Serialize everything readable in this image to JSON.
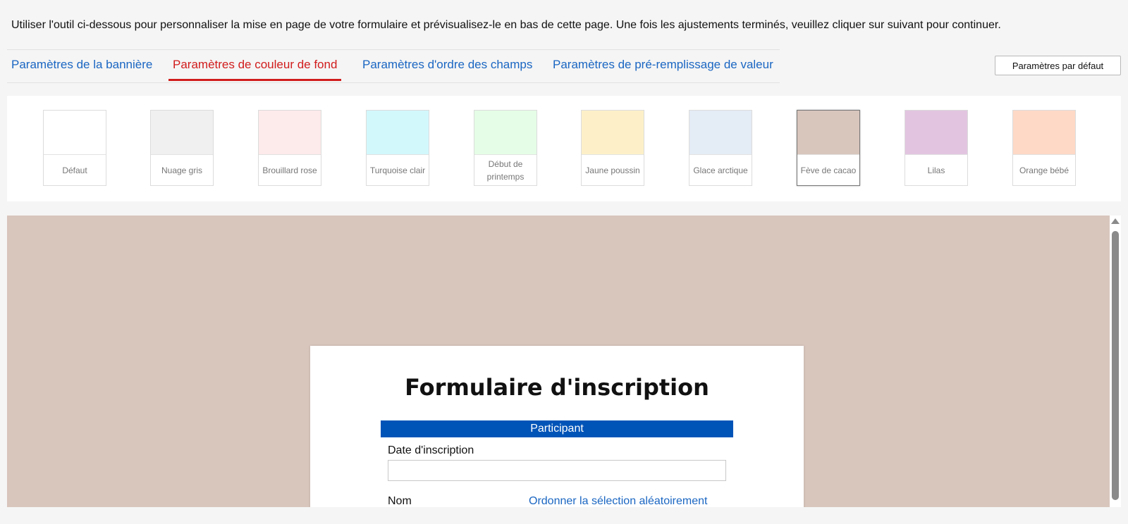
{
  "intro_text": "Utiliser l'outil ci-dessous pour personnaliser la mise en page de votre formulaire et prévisualisez-le en bas de cette page. Une fois les ajustements terminés, veuillez cliquer sur suivant pour continuer.",
  "tabs": [
    {
      "label": "Paramètres de la bannière",
      "active": false
    },
    {
      "label": "Paramètres de couleur de fond",
      "active": true
    },
    {
      "label": "Paramètres d'ordre des champs",
      "active": false
    },
    {
      "label": "Paramètres de pré-remplissage de valeur",
      "active": false
    }
  ],
  "default_button": "Paramètres par défaut",
  "swatches": [
    {
      "label": "Défaut",
      "color": "#ffffff",
      "selected": false
    },
    {
      "label": "Nuage gris",
      "color": "#f0f0f0",
      "selected": false
    },
    {
      "label": "Brouillard rose",
      "color": "#fdeaea",
      "selected": false
    },
    {
      "label": "Turquoise clair",
      "color": "#d2f8fc",
      "selected": false
    },
    {
      "label": "Début de printemps",
      "color": "#e5fde6",
      "selected": false
    },
    {
      "label": "Jaune poussin",
      "color": "#fdf0c8",
      "selected": false
    },
    {
      "label": "Glace arctique",
      "color": "#e4ecf6",
      "selected": false
    },
    {
      "label": "Fève de cacao",
      "color": "#d8c5bc",
      "selected": true
    },
    {
      "label": "Lilas",
      "color": "#e2c4e0",
      "selected": false
    },
    {
      "label": "Orange bébé",
      "color": "#fed9c6",
      "selected": false
    }
  ],
  "preview": {
    "background_color": "#d8c5bc",
    "form_title": "Formulaire d'inscription",
    "section_title": "Participant",
    "section_color": "#0054b8",
    "field_date_label": "Date d'inscription",
    "field_nom_label": "Nom",
    "random_link": "Ordonner la sélection aléatoirement"
  }
}
